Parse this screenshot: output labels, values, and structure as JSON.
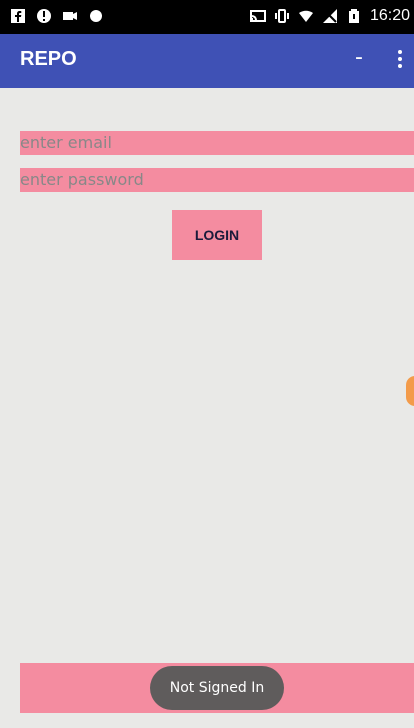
{
  "status_bar": {
    "time": "16:20",
    "left_icons": [
      "facebook-icon",
      "alert-icon",
      "camera-icon",
      "dot-icon"
    ],
    "right_icons": [
      "cast-icon",
      "vibrate-icon",
      "wifi-icon",
      "no-signal-icon",
      "battery-icon"
    ]
  },
  "app_bar": {
    "title": "REPO",
    "minus_label": "-",
    "overflow_icon": "overflow-menu-icon",
    "color": "#3f51b5"
  },
  "form": {
    "email_placeholder": "enter email",
    "password_placeholder": "enter password",
    "login_label": "LOGIN",
    "field_color": "#f48ca0"
  },
  "toast": {
    "text": "Not Signed In"
  }
}
